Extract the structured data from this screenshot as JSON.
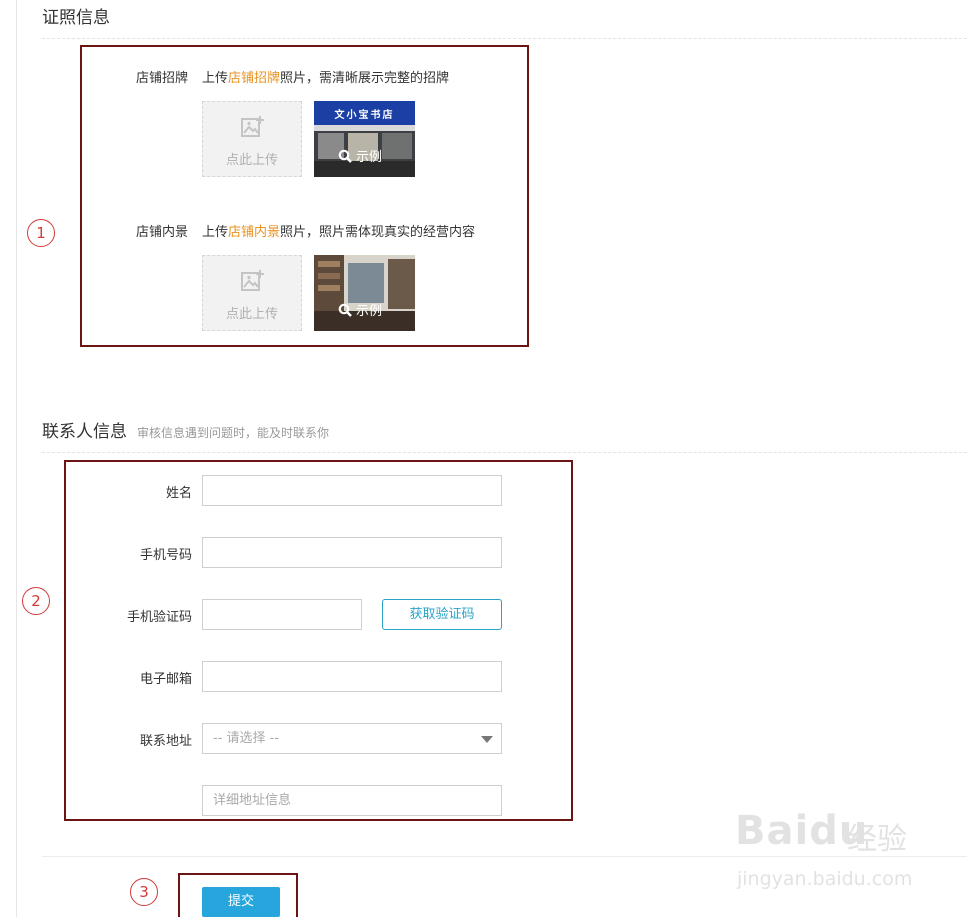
{
  "license": {
    "title": "证照信息",
    "items": [
      {
        "label": "店铺招牌",
        "hint_pre": "上传",
        "hint_hl": "店铺招牌",
        "hint_post": "照片，需清晰展示完整的招牌",
        "upload_text": "点此上传",
        "example_text": "示例",
        "sign_text": "文小宝书店"
      },
      {
        "label": "店铺内景",
        "hint_pre": "上传",
        "hint_hl": "店铺内景",
        "hint_post": "照片，照片需体现真实的经营内容",
        "upload_text": "点此上传",
        "example_text": "示例"
      }
    ]
  },
  "contact": {
    "title": "联系人信息",
    "subtitle": "审核信息遇到问题时，能及时联系你",
    "fields": {
      "name_label": "姓名",
      "phone_label": "手机号码",
      "code_label": "手机验证码",
      "code_button": "获取验证码",
      "email_label": "电子邮箱",
      "address_label": "联系地址",
      "address_select": "-- 请选择 --",
      "address_detail_placeholder": "详细地址信息"
    }
  },
  "submit_label": "提交",
  "annotations": [
    "1",
    "2",
    "3"
  ],
  "watermark": {
    "brand": "Baidu",
    "cn": "经验",
    "url": "jingyan.baidu.com"
  },
  "colors": {
    "annotation_box": "#6b1414",
    "annotation_circle": "#d23b3b",
    "highlight": "#e8921f",
    "accent": "#27a6dd"
  }
}
